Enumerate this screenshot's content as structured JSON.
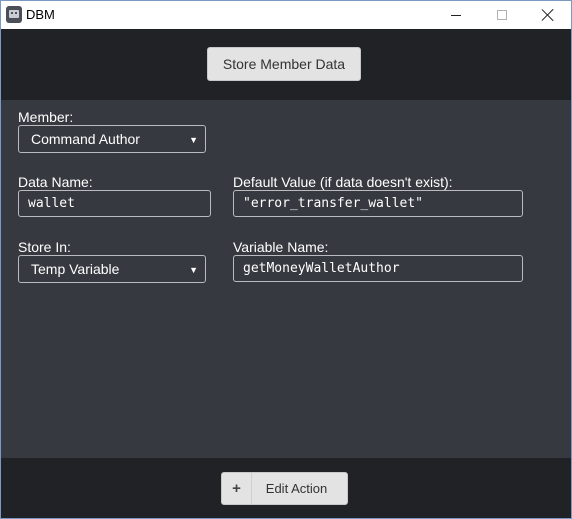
{
  "window": {
    "title": "DBM"
  },
  "header": {
    "store_button": "Store Member Data"
  },
  "form": {
    "member_label": "Member:",
    "member_value": "Command Author",
    "data_name_label": "Data Name:",
    "data_name_value": "wallet",
    "default_value_label": "Default Value (if data doesn't exist):",
    "default_value_value": "\"error_transfer_wallet\"",
    "store_in_label": "Store In:",
    "store_in_value": "Temp Variable",
    "variable_name_label": "Variable Name:",
    "variable_name_value": "getMoneyWalletAuthor"
  },
  "footer": {
    "plus": "+",
    "edit_action": "Edit Action"
  },
  "icons": {
    "app": "app-icon",
    "minimize": "minimize-icon",
    "maximize": "maximize-icon",
    "close": "close-icon",
    "caret": "chevron-down-icon"
  },
  "colors": {
    "panel": "#36393f",
    "band": "#202225",
    "button": "#e3e3e3"
  }
}
